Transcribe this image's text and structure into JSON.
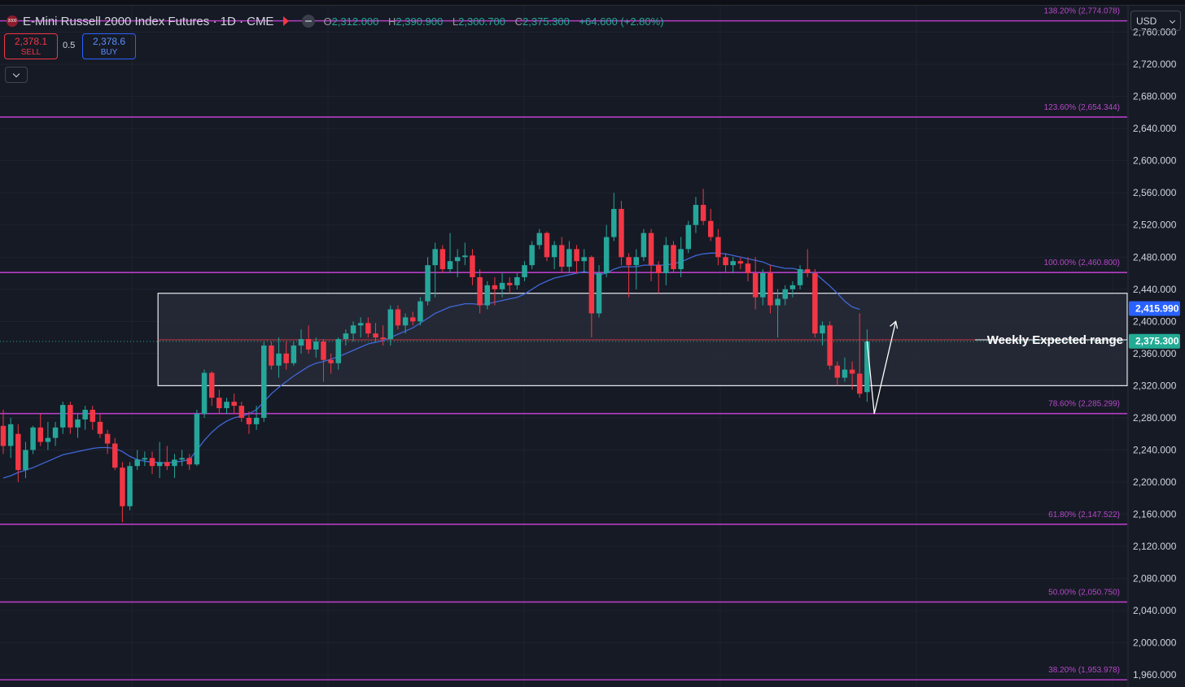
{
  "header": {
    "logo_text": "2000",
    "title": "E-Mini Russell 2000 Index Futures · 1D · CME",
    "ohlc": {
      "o_label": "O",
      "o": "2,312.000",
      "h_label": "H",
      "h": "2,390.900",
      "l_label": "L",
      "l": "2,300.700",
      "c_label": "C",
      "c": "2,375.300",
      "change": "+64.600 (+2.80%)"
    }
  },
  "trade": {
    "sell_price": "2,378.1",
    "sell_label": "SELL",
    "spread": "0.5",
    "buy_price": "2,378.6",
    "buy_label": "BUY"
  },
  "currency": "USD",
  "colors": {
    "background": "#161a25",
    "up": "#26a69a",
    "down": "#f23645",
    "fib": "#b53ec4",
    "fib_text": "#b548c6",
    "ma": "#3f68d8",
    "box_border": "#e9ecf2",
    "box_fill": "#2a2e3b",
    "current": "#22ab94",
    "ma_label": "#2962ff"
  },
  "chart_data": {
    "type": "candlestick",
    "ylim": [
      1945,
      2800
    ],
    "y_ticks": [
      "2,760.000",
      "2,720.000",
      "2,680.000",
      "2,640.000",
      "2,600.000",
      "2,560.000",
      "2,520.000",
      "2,480.000",
      "2,440.000",
      "2,400.000",
      "2,360.000",
      "2,320.000",
      "2,280.000",
      "2,240.000",
      "2,200.000",
      "2,160.000",
      "2,120.000",
      "2,080.000",
      "2,040.000",
      "2,000.000",
      "1,960.000"
    ],
    "y_tick_values": [
      2760,
      2720,
      2680,
      2640,
      2600,
      2560,
      2520,
      2480,
      2440,
      2400,
      2360,
      2320,
      2280,
      2240,
      2200,
      2160,
      2120,
      2080,
      2040,
      2000,
      1960
    ],
    "candles": [
      [
        2270,
        2290,
        2235,
        2245
      ],
      [
        2245,
        2280,
        2230,
        2272
      ],
      [
        2260,
        2272,
        2200,
        2215
      ],
      [
        2215,
        2250,
        2205,
        2240
      ],
      [
        2240,
        2270,
        2235,
        2268
      ],
      [
        2268,
        2285,
        2245,
        2250
      ],
      [
        2250,
        2275,
        2240,
        2255
      ],
      [
        2255,
        2275,
        2245,
        2268
      ],
      [
        2268,
        2300,
        2260,
        2296
      ],
      [
        2296,
        2300,
        2260,
        2268
      ],
      [
        2268,
        2285,
        2255,
        2278
      ],
      [
        2278,
        2295,
        2265,
        2290
      ],
      [
        2290,
        2295,
        2265,
        2275
      ],
      [
        2275,
        2285,
        2255,
        2260
      ],
      [
        2260,
        2265,
        2235,
        2248
      ],
      [
        2248,
        2255,
        2215,
        2218
      ],
      [
        2218,
        2225,
        2150,
        2170
      ],
      [
        2170,
        2225,
        2165,
        2220
      ],
      [
        2220,
        2240,
        2215,
        2228
      ],
      [
        2228,
        2238,
        2220,
        2230
      ],
      [
        2230,
        2238,
        2210,
        2220
      ],
      [
        2220,
        2250,
        2205,
        2225
      ],
      [
        2225,
        2245,
        2215,
        2220
      ],
      [
        2220,
        2235,
        2205,
        2228
      ],
      [
        2228,
        2240,
        2220,
        2230
      ],
      [
        2230,
        2235,
        2215,
        2222
      ],
      [
        2222,
        2290,
        2220,
        2285
      ],
      [
        2285,
        2340,
        2280,
        2336
      ],
      [
        2336,
        2338,
        2295,
        2305
      ],
      [
        2305,
        2315,
        2285,
        2292
      ],
      [
        2292,
        2305,
        2285,
        2300
      ],
      [
        2300,
        2310,
        2285,
        2295
      ],
      [
        2295,
        2300,
        2275,
        2280
      ],
      [
        2280,
        2288,
        2260,
        2272
      ],
      [
        2272,
        2295,
        2265,
        2280
      ],
      [
        2280,
        2375,
        2275,
        2370
      ],
      [
        2370,
        2375,
        2340,
        2345
      ],
      [
        2345,
        2380,
        2330,
        2360
      ],
      [
        2360,
        2375,
        2340,
        2348
      ],
      [
        2348,
        2375,
        2345,
        2370
      ],
      [
        2370,
        2390,
        2360,
        2378
      ],
      [
        2378,
        2395,
        2360,
        2365
      ],
      [
        2365,
        2380,
        2355,
        2375
      ],
      [
        2375,
        2378,
        2325,
        2352
      ],
      [
        2352,
        2360,
        2335,
        2348
      ],
      [
        2348,
        2380,
        2340,
        2378
      ],
      [
        2378,
        2390,
        2370,
        2385
      ],
      [
        2385,
        2400,
        2375,
        2395
      ],
      [
        2395,
        2405,
        2380,
        2398
      ],
      [
        2398,
        2405,
        2380,
        2385
      ],
      [
        2385,
        2398,
        2375,
        2380
      ],
      [
        2380,
        2395,
        2370,
        2378
      ],
      [
        2378,
        2420,
        2370,
        2415
      ],
      [
        2415,
        2420,
        2390,
        2395
      ],
      [
        2395,
        2410,
        2385,
        2405
      ],
      [
        2405,
        2412,
        2395,
        2400
      ],
      [
        2400,
        2430,
        2395,
        2425
      ],
      [
        2425,
        2480,
        2420,
        2470
      ],
      [
        2470,
        2498,
        2430,
        2490
      ],
      [
        2490,
        2495,
        2460,
        2465
      ],
      [
        2465,
        2510,
        2460,
        2475
      ],
      [
        2475,
        2490,
        2455,
        2480
      ],
      [
        2480,
        2498,
        2470,
        2482
      ],
      [
        2482,
        2490,
        2445,
        2455
      ],
      [
        2455,
        2465,
        2410,
        2420
      ],
      [
        2420,
        2450,
        2415,
        2445
      ],
      [
        2445,
        2455,
        2420,
        2440
      ],
      [
        2440,
        2460,
        2430,
        2448
      ],
      [
        2448,
        2455,
        2435,
        2445
      ],
      [
        2445,
        2460,
        2440,
        2455
      ],
      [
        2455,
        2475,
        2450,
        2470
      ],
      [
        2470,
        2500,
        2465,
        2495
      ],
      [
        2495,
        2515,
        2490,
        2510
      ],
      [
        2510,
        2512,
        2475,
        2480
      ],
      [
        2480,
        2500,
        2465,
        2495
      ],
      [
        2495,
        2505,
        2460,
        2468
      ],
      [
        2468,
        2500,
        2460,
        2490
      ],
      [
        2490,
        2495,
        2460,
        2475
      ],
      [
        2475,
        2490,
        2460,
        2480
      ],
      [
        2480,
        2482,
        2380,
        2410
      ],
      [
        2410,
        2470,
        2405,
        2460
      ],
      [
        2460,
        2520,
        2455,
        2505
      ],
      [
        2505,
        2560,
        2500,
        2540
      ],
      [
        2540,
        2550,
        2470,
        2480
      ],
      [
        2480,
        2485,
        2430,
        2470
      ],
      [
        2470,
        2490,
        2440,
        2480
      ],
      [
        2480,
        2515,
        2475,
        2510
      ],
      [
        2510,
        2515,
        2450,
        2470
      ],
      [
        2470,
        2475,
        2435,
        2460
      ],
      [
        2460,
        2505,
        2445,
        2495
      ],
      [
        2495,
        2500,
        2460,
        2465
      ],
      [
        2465,
        2505,
        2455,
        2490
      ],
      [
        2490,
        2525,
        2485,
        2520
      ],
      [
        2520,
        2555,
        2510,
        2545
      ],
      [
        2545,
        2565,
        2520,
        2525
      ],
      [
        2525,
        2540,
        2500,
        2505
      ],
      [
        2505,
        2515,
        2470,
        2480
      ],
      [
        2480,
        2485,
        2460,
        2470
      ],
      [
        2470,
        2480,
        2460,
        2475
      ],
      [
        2475,
        2480,
        2465,
        2472
      ],
      [
        2472,
        2480,
        2450,
        2460
      ],
      [
        2460,
        2480,
        2415,
        2430
      ],
      [
        2430,
        2465,
        2420,
        2460
      ],
      [
        2460,
        2470,
        2410,
        2420
      ],
      [
        2420,
        2440,
        2380,
        2428
      ],
      [
        2428,
        2445,
        2420,
        2440
      ],
      [
        2440,
        2450,
        2430,
        2445
      ],
      [
        2445,
        2470,
        2440,
        2465
      ],
      [
        2465,
        2490,
        2455,
        2460
      ],
      [
        2460,
        2465,
        2380,
        2385
      ],
      [
        2385,
        2400,
        2370,
        2395
      ],
      [
        2395,
        2400,
        2340,
        2345
      ],
      [
        2345,
        2350,
        2320,
        2330
      ],
      [
        2330,
        2355,
        2325,
        2340
      ],
      [
        2340,
        2350,
        2315,
        2335
      ],
      [
        2335,
        2410,
        2305,
        2310
      ],
      [
        2312,
        2390,
        2300,
        2375
      ]
    ],
    "ma": [
      2205,
      2208,
      2212,
      2215,
      2218,
      2222,
      2226,
      2230,
      2234,
      2236,
      2238,
      2240,
      2242,
      2243,
      2243,
      2242,
      2238,
      2232,
      2228,
      2226,
      2225,
      2224,
      2224,
      2225,
      2226,
      2228,
      2240,
      2252,
      2262,
      2270,
      2276,
      2280,
      2282,
      2285,
      2290,
      2300,
      2310,
      2318,
      2325,
      2332,
      2338,
      2344,
      2348,
      2350,
      2353,
      2356,
      2360,
      2364,
      2368,
      2372,
      2374,
      2376,
      2380,
      2384,
      2388,
      2392,
      2398,
      2404,
      2410,
      2414,
      2418,
      2420,
      2422,
      2422,
      2421,
      2422,
      2424,
      2426,
      2428,
      2430,
      2434,
      2440,
      2446,
      2450,
      2454,
      2456,
      2458,
      2460,
      2462,
      2460,
      2458,
      2460,
      2465,
      2468,
      2468,
      2468,
      2470,
      2470,
      2470,
      2470,
      2472,
      2474,
      2478,
      2482,
      2484,
      2485,
      2485,
      2484,
      2482,
      2480,
      2478,
      2476,
      2474,
      2470,
      2468,
      2466,
      2466,
      2464,
      2462,
      2460,
      2452,
      2444,
      2435,
      2425,
      2418,
      2415
    ],
    "fib_levels": [
      {
        "label": "138.20% (2,774.078)",
        "value": 2774.078
      },
      {
        "label": "123.60% (2,654.344)",
        "value": 2654.344
      },
      {
        "label": "100.00% (2,460.800)",
        "value": 2460.8
      },
      {
        "label": "78.60% (2,285.299)",
        "value": 2285.299
      },
      {
        "label": "61.80% (2,147.522)",
        "value": 2147.522
      },
      {
        "label": "50.00% (2,050.750)",
        "value": 2050.75
      },
      {
        "label": "38.20% (1,953.978)",
        "value": 1953.978
      }
    ],
    "range_box": {
      "from_index": 21,
      "to_index": -1,
      "top": 2435,
      "bottom": 2320
    },
    "range_label": "Weekly Expected range",
    "projection": [
      [
        2375.3,
        0
      ],
      [
        2285,
        1
      ],
      [
        2400,
        4
      ]
    ],
    "price_labels": [
      {
        "text": "2,415.990",
        "value": 2415.99,
        "kind": "ma"
      },
      {
        "text": "2,375.300",
        "value": 2375.3,
        "kind": "current"
      }
    ]
  }
}
